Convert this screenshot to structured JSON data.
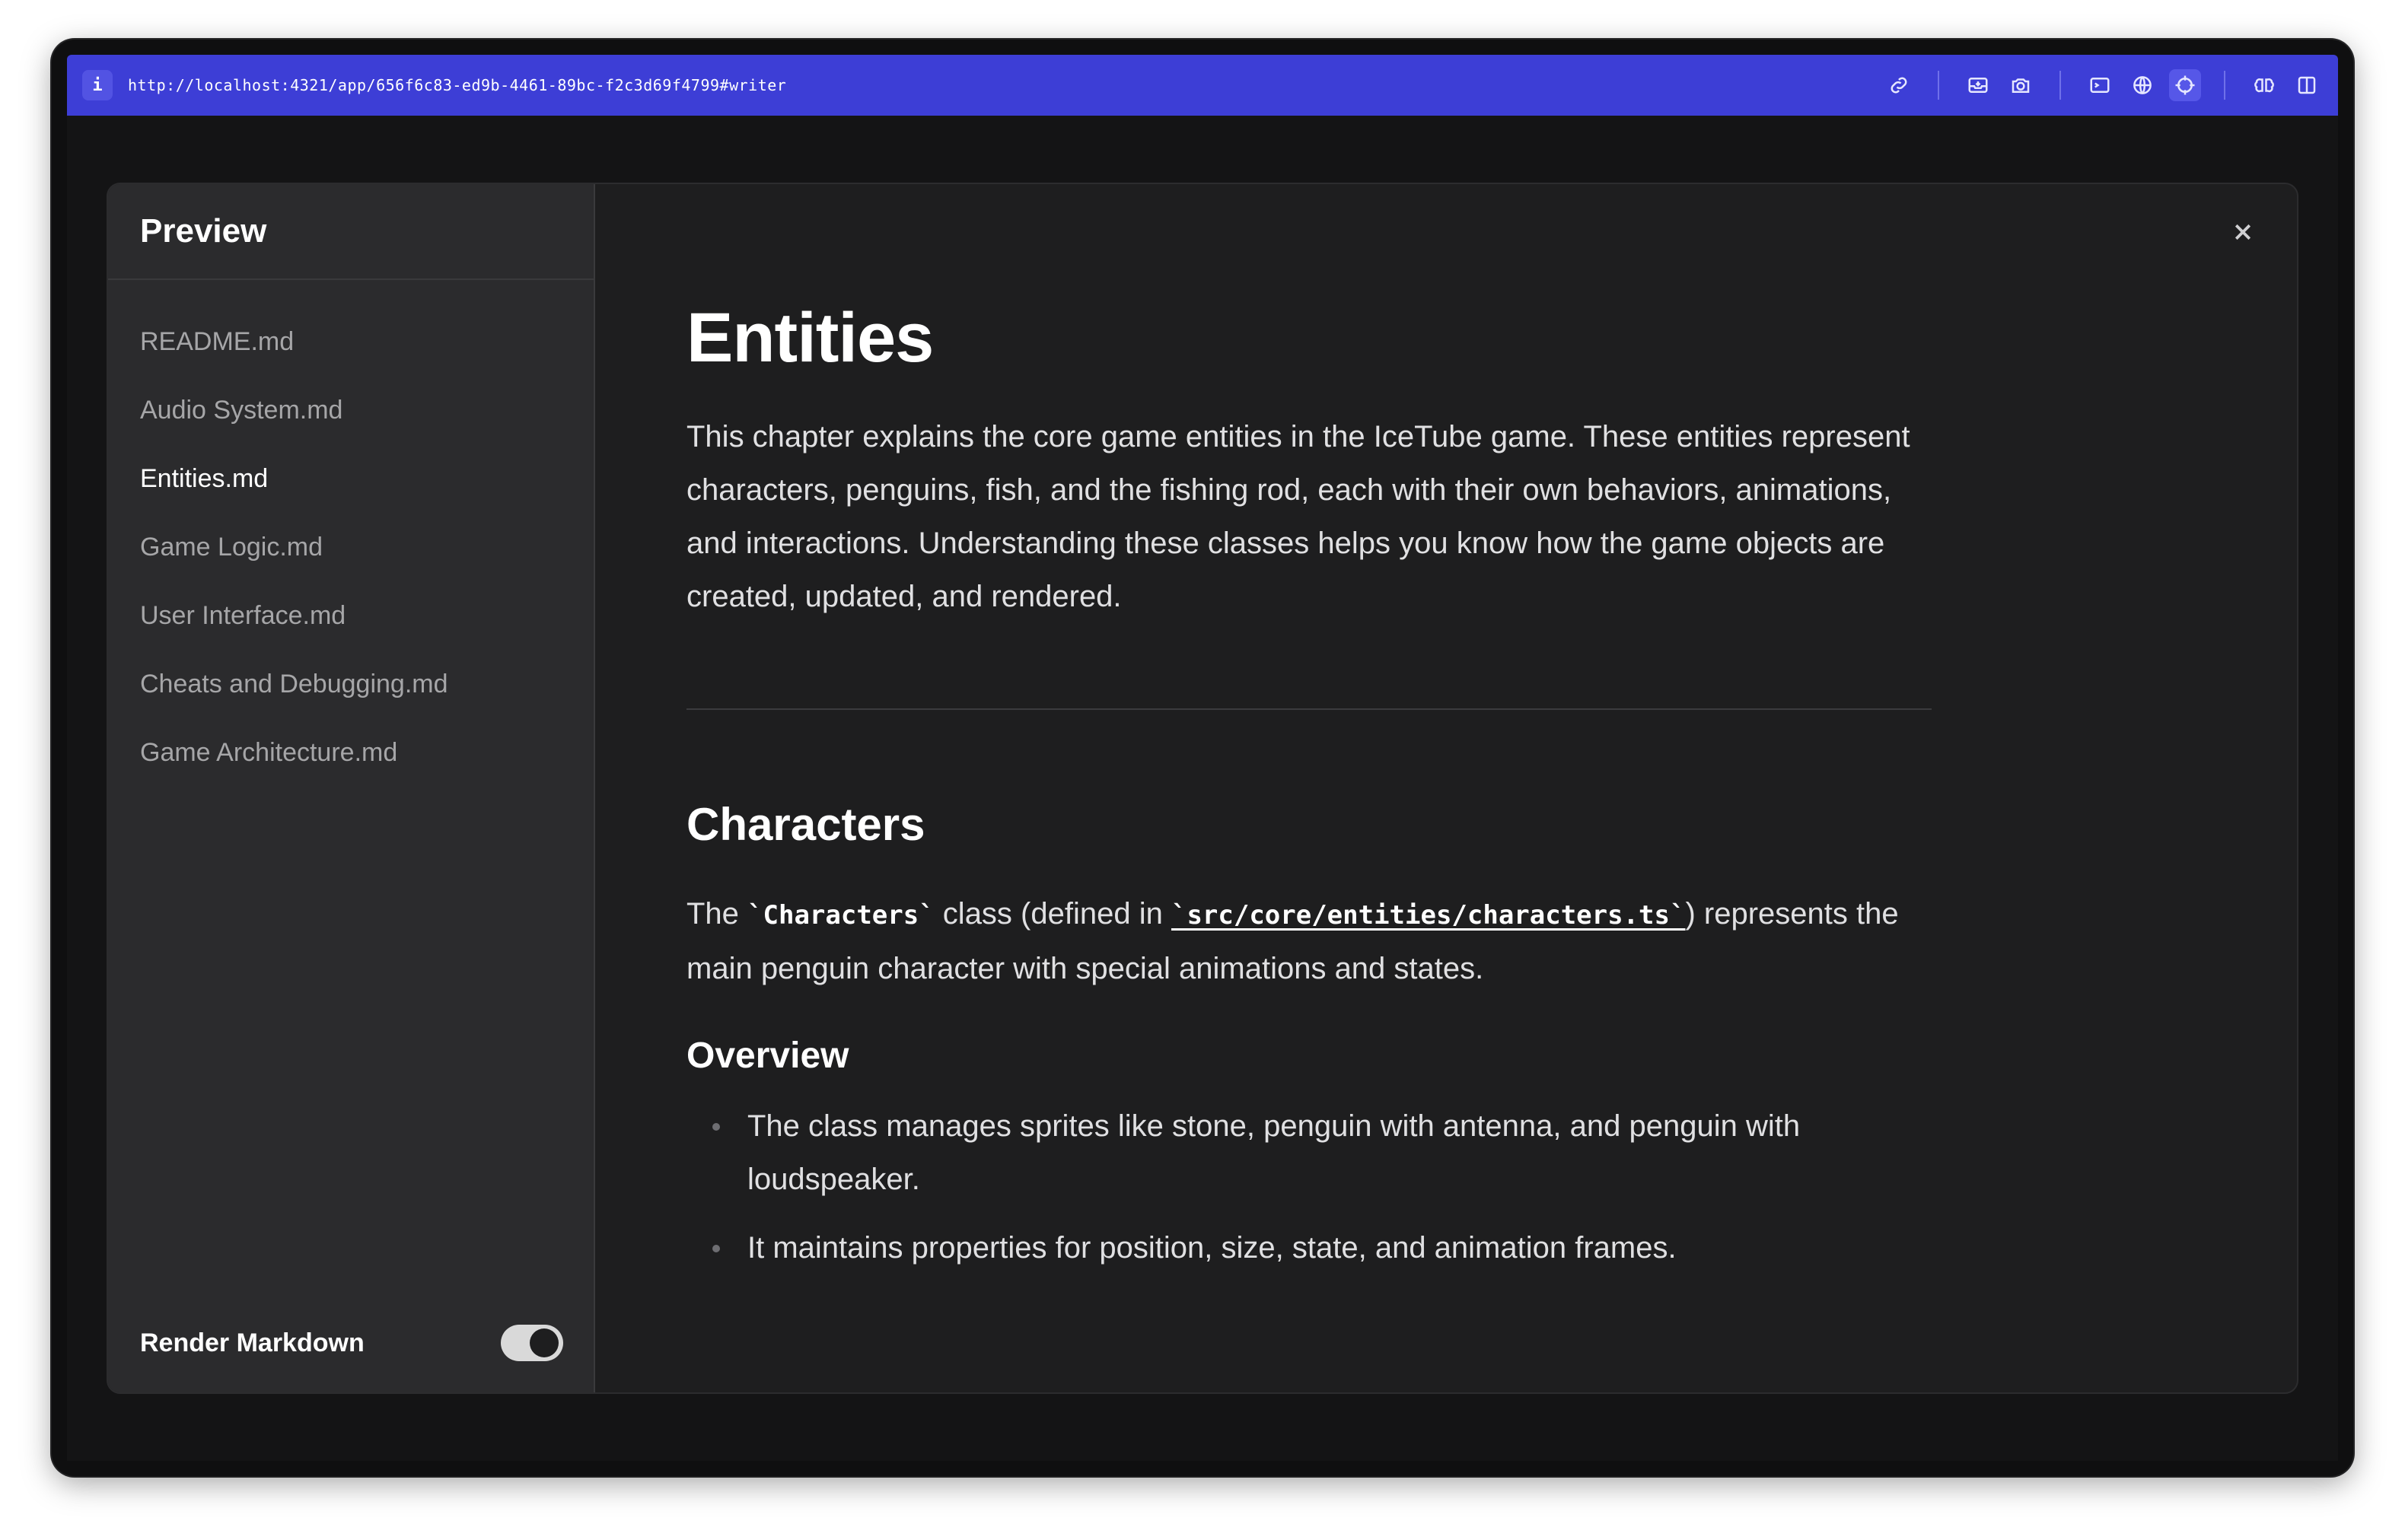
{
  "browser": {
    "info_label": "i",
    "url": "http://localhost:4321/app/656f6c83-ed9b-4461-89bc-f2c3d69f4799#writer",
    "toolbar_icons": [
      "link-icon",
      "inbox-icon",
      "camera-icon",
      "terminal-icon",
      "globe-icon",
      "crosshair-icon",
      "brain-icon",
      "split-view-icon"
    ]
  },
  "sidebar": {
    "title": "Preview",
    "files": [
      {
        "label": "README.md",
        "active": false
      },
      {
        "label": "Audio System.md",
        "active": false
      },
      {
        "label": "Entities.md",
        "active": true
      },
      {
        "label": "Game Logic.md",
        "active": false
      },
      {
        "label": "User Interface.md",
        "active": false
      },
      {
        "label": "Cheats and Debugging.md",
        "active": false
      },
      {
        "label": "Game Architecture.md",
        "active": false
      }
    ],
    "footer": {
      "label": "Render Markdown",
      "toggle_on": true
    }
  },
  "article": {
    "title": "Entities",
    "intro": "This chapter explains the core game entities in the IceTube game. These entities represent characters, penguins, fish, and the fishing rod, each with their own behaviors, animations, and interactions. Understanding these classes helps you know how the game objects are created, updated, and rendered.",
    "section_title": "Characters",
    "para_prefix": "The ",
    "para_code": "`Characters`",
    "para_mid": " class (defined in ",
    "para_link": "`src/core/entities/characters.ts`",
    "para_suffix": ") represents the main penguin character with special animations and states.",
    "subsection_title": "Overview",
    "bullets": [
      "The class manages sprites like stone, penguin with antenna, and penguin with loudspeaker.",
      "It maintains properties for position, size, state, and animation frames."
    ]
  },
  "colors": {
    "url_bar": "#3d3ed6",
    "sidebar_bg": "#2b2b2d",
    "content_bg": "#1e1e1f"
  }
}
